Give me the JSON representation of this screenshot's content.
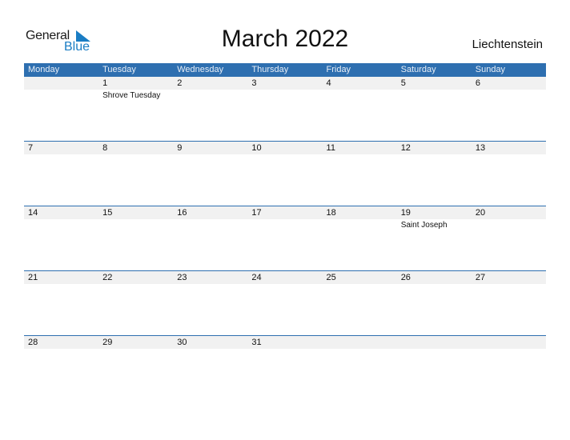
{
  "logo": {
    "word1": "General",
    "word2": "Blue"
  },
  "title": "March 2022",
  "country": "Liechtenstein",
  "colors": {
    "header": "#2e6fb0",
    "brand_blue": "#1a7dc4",
    "row_bg": "#f1f1f1"
  },
  "weekdays": [
    "Monday",
    "Tuesday",
    "Wednesday",
    "Thursday",
    "Friday",
    "Saturday",
    "Sunday"
  ],
  "weeks": [
    [
      {
        "day": ""
      },
      {
        "day": "1",
        "event": "Shrove Tuesday"
      },
      {
        "day": "2"
      },
      {
        "day": "3"
      },
      {
        "day": "4"
      },
      {
        "day": "5"
      },
      {
        "day": "6"
      }
    ],
    [
      {
        "day": "7"
      },
      {
        "day": "8"
      },
      {
        "day": "9"
      },
      {
        "day": "10"
      },
      {
        "day": "11"
      },
      {
        "day": "12"
      },
      {
        "day": "13"
      }
    ],
    [
      {
        "day": "14"
      },
      {
        "day": "15"
      },
      {
        "day": "16"
      },
      {
        "day": "17"
      },
      {
        "day": "18"
      },
      {
        "day": "19",
        "event": "Saint Joseph"
      },
      {
        "day": "20"
      }
    ],
    [
      {
        "day": "21"
      },
      {
        "day": "22"
      },
      {
        "day": "23"
      },
      {
        "day": "24"
      },
      {
        "day": "25"
      },
      {
        "day": "26"
      },
      {
        "day": "27"
      }
    ],
    [
      {
        "day": "28"
      },
      {
        "day": "29"
      },
      {
        "day": "30"
      },
      {
        "day": "31"
      },
      {
        "day": ""
      },
      {
        "day": ""
      },
      {
        "day": ""
      }
    ]
  ]
}
